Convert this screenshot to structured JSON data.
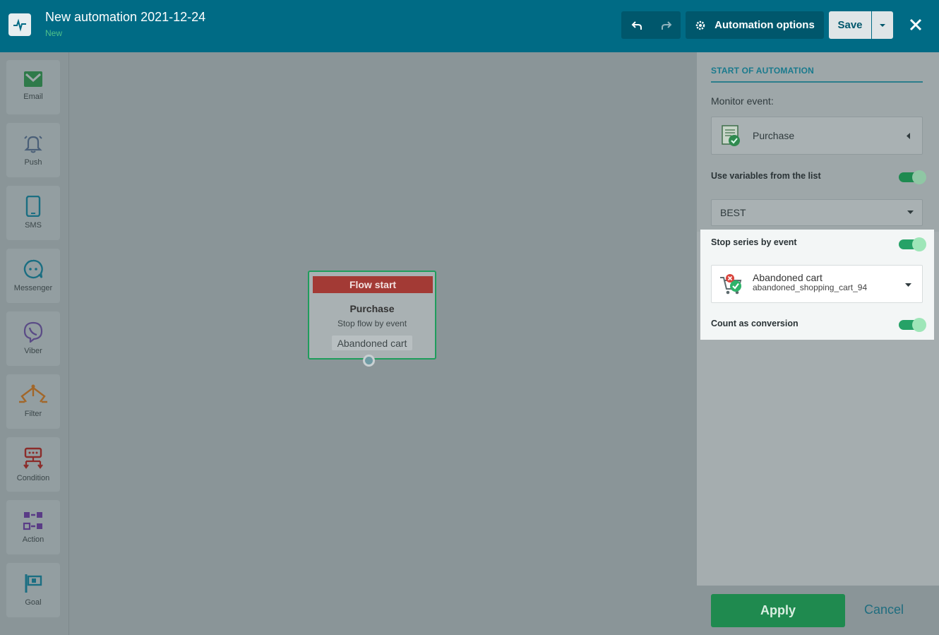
{
  "header": {
    "title": "New automation 2021-12-24",
    "status": "New",
    "options_label": "Automation options",
    "save_label": "Save"
  },
  "toolbar": {
    "items": [
      {
        "label": "Email",
        "icon": "envelope-icon"
      },
      {
        "label": "Push",
        "icon": "bell-icon"
      },
      {
        "label": "SMS",
        "icon": "phone-icon"
      },
      {
        "label": "Messenger",
        "icon": "chat-icon"
      },
      {
        "label": "Viber",
        "icon": "viber-icon"
      },
      {
        "label": "Filter",
        "icon": "filter-icon"
      },
      {
        "label": "Condition",
        "icon": "condition-icon"
      },
      {
        "label": "Action",
        "icon": "action-icon"
      },
      {
        "label": "Goal",
        "icon": "flag-icon"
      }
    ]
  },
  "node": {
    "header": "Flow start",
    "title": "Purchase",
    "subtitle": "Stop flow by event",
    "tag": "Abandoned cart"
  },
  "panel": {
    "section_title": "START OF AUTOMATION",
    "monitor_label": "Monitor event:",
    "monitor_value": "Purchase",
    "use_vars_label": "Use variables from the list",
    "use_vars_on": true,
    "list_value": "BEST",
    "stop_series_label": "Stop series by event",
    "stop_series_on": true,
    "stop_event_name": "Abandoned cart",
    "stop_event_id": "abandoned_shopping_cart_94",
    "conversion_label": "Count as conversion",
    "conversion_on": true
  },
  "footer": {
    "apply_label": "Apply",
    "cancel_label": "Cancel"
  },
  "colors": {
    "header_bg": "#006b85",
    "accent_green": "#1f8a4f",
    "node_header": "#a33a35"
  }
}
